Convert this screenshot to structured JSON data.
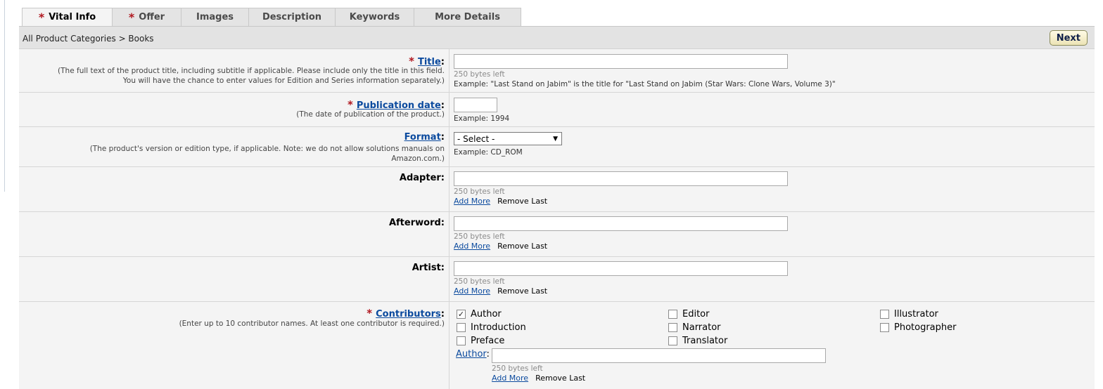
{
  "tabs": [
    {
      "label": "Vital Info",
      "required": true,
      "active": true
    },
    {
      "label": "Offer",
      "required": true,
      "active": false
    },
    {
      "label": "Images",
      "required": false,
      "active": false
    },
    {
      "label": "Description",
      "required": false,
      "active": false
    },
    {
      "label": "Keywords",
      "required": false,
      "active": false
    },
    {
      "label": "More Details",
      "required": false,
      "active": false
    }
  ],
  "breadcrumb": "All Product Categories > Books",
  "next_label": "Next",
  "required_glyph": "*",
  "colon": ":",
  "fields": {
    "title": {
      "label": "Title",
      "help1": "(The full text of the product title, including subtitle if applicable. Please include only the title in this field.",
      "help2": "You will have the chance to enter values for Edition and Series information separately.)",
      "value": "",
      "bytes_left": "250 bytes left",
      "example": "Example: \"Last Stand on Jabim\" is the title for \"Last Stand on Jabim (Star Wars: Clone Wars, Volume 3)\""
    },
    "publication_date": {
      "label": "Publication date",
      "help": "(The date of publication of the product.)",
      "value": "",
      "example": "Example: 1994"
    },
    "format": {
      "label": "Format",
      "help1": "(The product's version or edition type, if applicable. Note: we do not allow solutions manuals on",
      "help2": "Amazon.com.)",
      "selected": "- Select -",
      "example": "Example: CD_ROM"
    },
    "adapter": {
      "label": "Adapter",
      "value": "",
      "bytes_left": "250 bytes left"
    },
    "afterword": {
      "label": "Afterword",
      "value": "",
      "bytes_left": "250 bytes left"
    },
    "artist": {
      "label": "Artist",
      "value": "",
      "bytes_left": "250 bytes left"
    },
    "add_more": "Add More",
    "remove_last": "Remove Last",
    "contributors": {
      "label": "Contributors",
      "help": "(Enter up to 10 contributor names. At least one contributor is required.)",
      "options": [
        {
          "label": "Author",
          "checked": true
        },
        {
          "label": "Editor",
          "checked": false
        },
        {
          "label": "Illustrator",
          "checked": false
        },
        {
          "label": "Introduction",
          "checked": false
        },
        {
          "label": "Narrator",
          "checked": false
        },
        {
          "label": "Photographer",
          "checked": false
        },
        {
          "label": "Preface",
          "checked": false
        },
        {
          "label": "Translator",
          "checked": false
        }
      ],
      "author_label": "Author",
      "author_value": "",
      "author_bytes_left": "250 bytes left",
      "check_glyph": "✓"
    }
  },
  "colors": {
    "required": "#b0171f",
    "link": "#0b4a9e",
    "row_bg": "#f4f4f4",
    "bar_bg": "#e3e3e3"
  }
}
